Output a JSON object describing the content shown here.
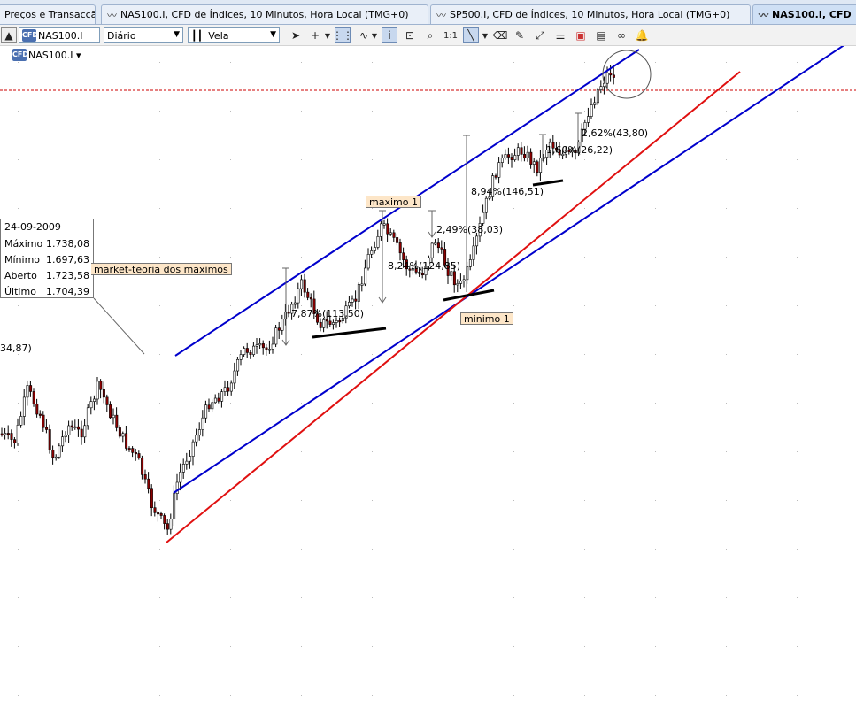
{
  "tabs": [
    {
      "label": "Preços e Transacção"
    },
    {
      "label": "NAS100.I, CFD de Índices, 10 Minutos, Hora Local (TMG+0)"
    },
    {
      "label": "SP500.I, CFD de Índices, 10 Minutos, Hora Local (TMG+0)"
    },
    {
      "label": "NAS100.I, CFD"
    }
  ],
  "toolbar": {
    "symbol_value": "NAS100.I",
    "period_value": "Diário",
    "chart_type_value": "Vela",
    "zoom_label": "1:1"
  },
  "symbol_bar": {
    "badge": "CFD",
    "label": "NAS100.I ▾"
  },
  "databox": {
    "date": "24-09-2009",
    "rows": [
      {
        "label": "Máximo",
        "value": "1.738,08"
      },
      {
        "label": "Mínimo",
        "value": "1.697,63"
      },
      {
        "label": "Aberto",
        "value": "1.723,58"
      },
      {
        "label": "Último",
        "value": "1.704,39"
      }
    ]
  },
  "annotations": {
    "maximo": "maximo 1",
    "minimo": "minimo 1",
    "market_label": "market-teoria dos maximos",
    "left_value": "34,87)",
    "pct1": "7,87%(113,50)",
    "pct2": "8,24%(124,85)",
    "pct3": "2,49%(38,03)",
    "pct4": "8,94%(146,51)",
    "pct5": "1,60%(26,22)",
    "pct6": "2,62%(43,80)"
  },
  "colors": {
    "channel_line": "#0000cc",
    "trend_line": "#e01010",
    "price_line": "#cc0000",
    "candle_up": "#ffffff",
    "candle_down": "#8b0000"
  }
}
